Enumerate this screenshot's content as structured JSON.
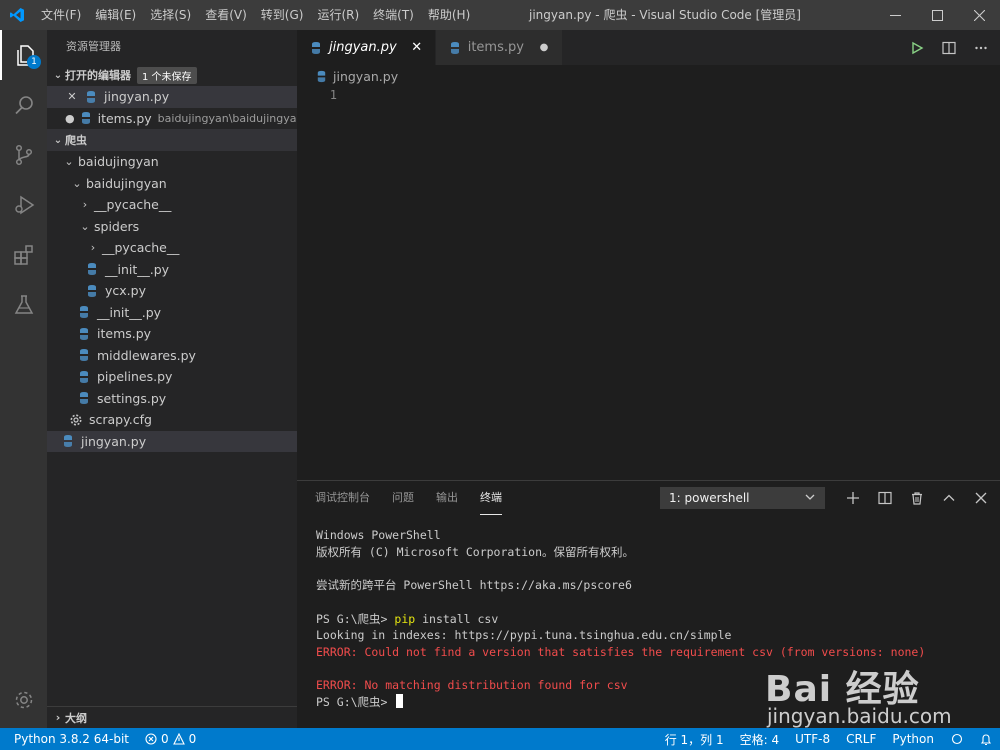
{
  "app": {
    "title": "jingyan.py - 爬虫 - Visual Studio Code [管理员]",
    "menu": [
      "文件(F)",
      "编辑(E)",
      "选择(S)",
      "查看(V)",
      "转到(G)",
      "运行(R)",
      "终端(T)",
      "帮助(H)"
    ]
  },
  "activity": {
    "explorer_badge": "1"
  },
  "sidebar": {
    "title": "资源管理器",
    "open_editors": {
      "label": "打开的编辑器",
      "badge": "1 个未保存",
      "items": [
        {
          "name": "jingyan.py",
          "desc": ""
        },
        {
          "name": "items.py",
          "desc": "baidujingyan\\baidujingyan"
        }
      ]
    },
    "folder": {
      "label": "爬虫",
      "tree": [
        {
          "name": "baidujingyan"
        },
        {
          "name": "baidujingyan"
        },
        {
          "name": "__pycache__"
        },
        {
          "name": "spiders"
        },
        {
          "name": "__pycache__"
        },
        {
          "name": "__init__.py"
        },
        {
          "name": "ycx.py"
        },
        {
          "name": "__init__.py"
        },
        {
          "name": "items.py"
        },
        {
          "name": "middlewares.py"
        },
        {
          "name": "pipelines.py"
        },
        {
          "name": "settings.py"
        },
        {
          "name": "scrapy.cfg"
        },
        {
          "name": "jingyan.py"
        }
      ]
    },
    "outline_label": "大纲"
  },
  "editor": {
    "tabs": [
      {
        "label": "jingyan.py"
      },
      {
        "label": "items.py"
      }
    ],
    "breadcrumb": "jingyan.py",
    "line_number": "1"
  },
  "panel": {
    "tabs": [
      "调试控制台",
      "问题",
      "输出",
      "终端"
    ],
    "terminal_select": "1: powershell",
    "lines": {
      "l1": "Windows PowerShell",
      "l2": "版权所有 (C) Microsoft Corporation。保留所有权利。",
      "l3": "尝试新的跨平台 PowerShell https://aka.ms/pscore6",
      "prompt": "PS G:\\爬虫> ",
      "cmd": "pip",
      "cmd_args": " install csv",
      "l5": "Looking in indexes: https://pypi.tuna.tsinghua.edu.cn/simple",
      "err1": "ERROR: Could not find a version that satisfies the requirement csv (from versions: none)",
      "err2": "ERROR: No matching distribution found for csv"
    }
  },
  "status": {
    "python": "Python 3.8.2 64-bit",
    "errors": "0",
    "warnings": "0",
    "position": "行 1，列 1",
    "spaces": "空格: 4",
    "encoding": "UTF-8",
    "eol": "CRLF",
    "language": "Python"
  },
  "watermark": {
    "logo": "Bai 经验",
    "url": "jingyan.baidu.com"
  },
  "colors": {
    "accent": "#007acc",
    "error": "#f14c4c",
    "command": "#e5e510"
  }
}
